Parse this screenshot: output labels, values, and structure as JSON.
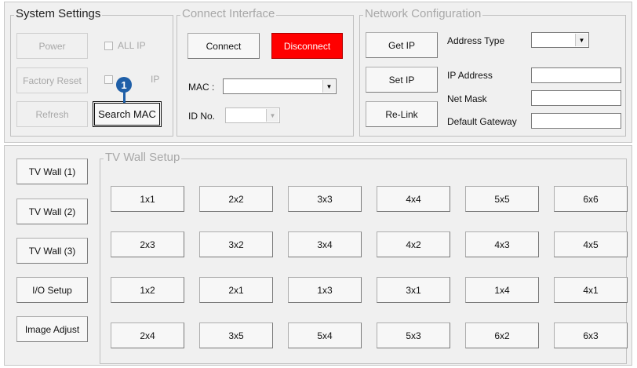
{
  "system_settings": {
    "title": "System Settings",
    "power_label": "Power",
    "all_ip_label": "ALL IP",
    "factory_reset_label": "Factory Reset",
    "ip_label": "IP",
    "refresh_label": "Refresh",
    "search_mac_label": "Search MAC"
  },
  "callout": {
    "number": "1"
  },
  "connect_interface": {
    "title": "Connect Interface",
    "connect_label": "Connect",
    "disconnect_label": "Disconnect",
    "mac_label": "MAC :",
    "mac_value": "",
    "id_label": "ID No.",
    "id_value": ""
  },
  "network": {
    "title": "Network Configuration",
    "get_ip_label": "Get IP",
    "set_ip_label": "Set IP",
    "relink_label": "Re-Link",
    "address_type_label": "Address Type",
    "address_type_value": "",
    "ip_address_label": "IP Address",
    "ip_address_value": "",
    "net_mask_label": "Net Mask",
    "net_mask_value": "",
    "gateway_label": "Default Gateway",
    "gateway_value": ""
  },
  "side_nav": [
    "TV Wall (1)",
    "TV Wall (2)",
    "TV Wall (3)",
    "I/O Setup",
    "Image Adjust"
  ],
  "tv_wall_setup": {
    "title": "TV Wall Setup",
    "rows": [
      [
        "1x1",
        "2x2",
        "3x3",
        "4x4",
        "5x5",
        "6x6"
      ],
      [
        "2x3",
        "3x2",
        "3x4",
        "4x2",
        "4x3",
        "4x5"
      ],
      [
        "1x2",
        "2x1",
        "1x3",
        "3x1",
        "1x4",
        "4x1"
      ],
      [
        "2x4",
        "3x5",
        "5x4",
        "5x3",
        "6x2",
        "6x3"
      ]
    ]
  },
  "colors": {
    "disconnect": "#ff0000",
    "callout": "#1f5fa8",
    "panel": "#f0f0f0"
  }
}
